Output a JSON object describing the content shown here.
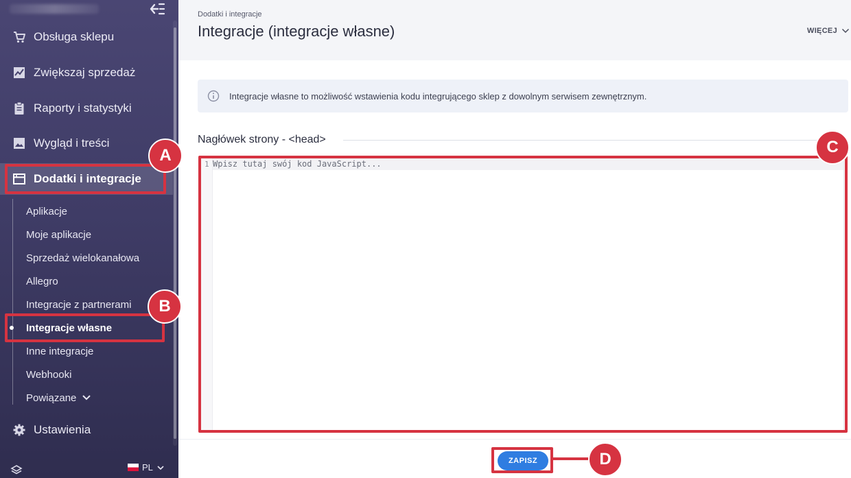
{
  "sidebar": {
    "nav": [
      {
        "label": "Obsługa sklepu",
        "icon": "cart-icon"
      },
      {
        "label": "Zwiększaj sprzedaż",
        "icon": "chart-icon"
      },
      {
        "label": "Raporty i statystyki",
        "icon": "clipboard-icon"
      },
      {
        "label": "Wygląd i treści",
        "icon": "image-icon"
      },
      {
        "label": "Dodatki i integracje",
        "icon": "window-icon"
      }
    ],
    "sub_items": [
      "Aplikacje",
      "Moje aplikacje",
      "Sprzedaż wielokanałowa",
      "Allegro",
      "Integracje z partnerami",
      "Integracje własne",
      "Inne integracje",
      "Webhooki",
      "Powiązane"
    ],
    "settings_label": "Ustawienia",
    "language": "PL"
  },
  "header": {
    "breadcrumb": "Dodatki i integracje",
    "title": "Integracje (integracje własne)",
    "more_label": "WIĘCEJ"
  },
  "info": {
    "text": "Integracje własne to możliwość wstawienia kodu integrującego sklep z dowolnym serwisem zewnętrznym."
  },
  "section": {
    "heading": "Nagłówek strony - <head>"
  },
  "editor": {
    "line_number": "1",
    "placeholder": "Wpisz tutaj swój kod JavaScript..."
  },
  "actions": {
    "save_label": "ZAPISZ"
  },
  "annotations": {
    "a": "A",
    "b": "B",
    "c": "C",
    "d": "D"
  },
  "colors": {
    "annotation": "#d63341",
    "primary": "#2f7de1",
    "sidebar": "#3f3c66"
  }
}
